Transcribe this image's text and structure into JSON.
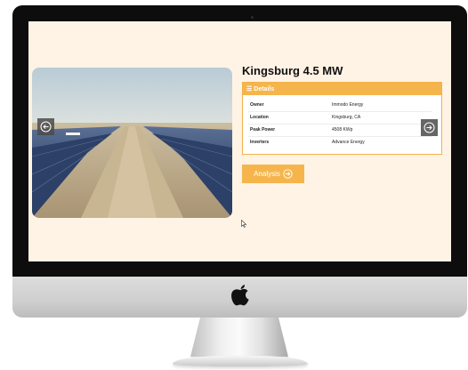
{
  "site": {
    "title": "Kingsburg 4.5 MW"
  },
  "details": {
    "header": "Details",
    "rows": [
      {
        "key": "Owner",
        "value": "Immodo Energy"
      },
      {
        "key": "Location",
        "value": "Kingsburg, CA"
      },
      {
        "key": "Peak Power",
        "value": "4508 KWp"
      },
      {
        "key": "Inverters",
        "value": "Advance Energy"
      }
    ]
  },
  "actions": {
    "analysis_label": "Analysis"
  },
  "icons": {
    "prev": "arrow-left-circle-icon",
    "next": "arrow-right-circle-icon",
    "menu": "menu-icon",
    "analysis": "arrow-right-circle-icon",
    "brand": "apple-icon",
    "cursor": "mouse-pointer-icon"
  },
  "colors": {
    "accent": "#f6b54c",
    "screen_background": "#fff3e5",
    "bezel": "#0d0d0d"
  }
}
